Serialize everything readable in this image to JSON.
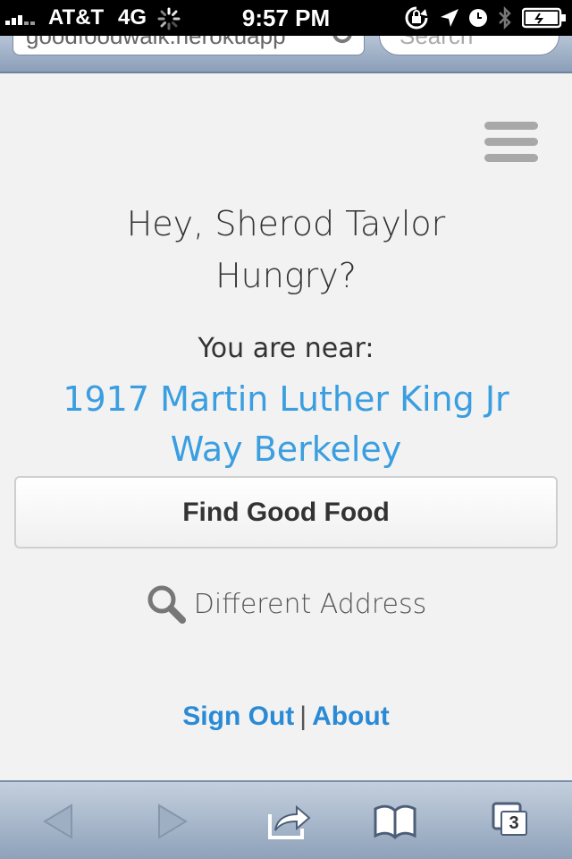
{
  "status_bar": {
    "carrier": "AT&T",
    "network": "4G",
    "time": "9:57 PM"
  },
  "browser": {
    "url_text": "goodfoodwalk.herokuapp",
    "search_placeholder": "Search"
  },
  "greeting": {
    "line1": "Hey, Sherod Taylor",
    "line2": "Hungry?"
  },
  "location": {
    "label": "You are near:",
    "address": "1917 Martin Luther King Jr Way Berkeley"
  },
  "actions": {
    "find_button": "Find Good Food",
    "different_address": "Different Address"
  },
  "footer": {
    "sign_out": "Sign Out",
    "separator": "|",
    "about": "About"
  },
  "toolbar": {
    "tabs_count": "3"
  },
  "colors": {
    "link_blue": "#3a9ee0",
    "background": "#f2f2f2"
  }
}
